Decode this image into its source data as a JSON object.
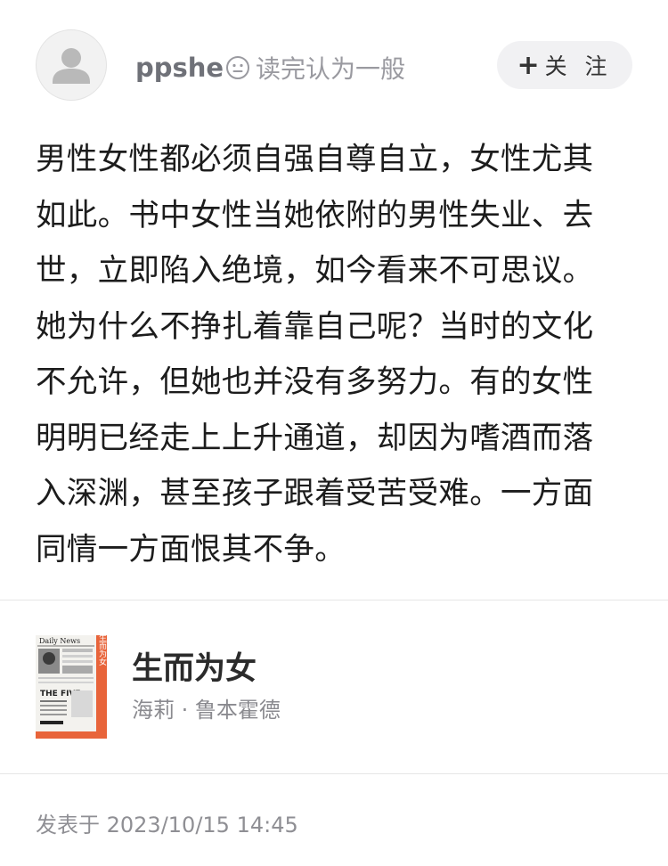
{
  "header": {
    "username": "ppshe",
    "rating_text": "读完认为一般",
    "rating_icon": "neutral-face-icon",
    "follow_label": "关 注",
    "follow_icon": "plus-icon"
  },
  "review": {
    "lines": [
      "男性女性都必须自强自尊自立，女性尤其",
      "如此。书中女性当她依附的男性失业、去",
      "世，立即陷入绝境，如今看来不可思议。",
      "她为什么不挣扎着靠自己呢？当时的文化",
      "不允许，但她也并没有多努力。有的女性",
      "明明已经走上上升通道，却因为嗜酒而落",
      "入深渊，甚至孩子跟着受苦受难。一方面",
      "同情一方面恨其不争。"
    ]
  },
  "book": {
    "title": "生而为女",
    "author": "海莉 · 鲁本霍德",
    "cover_text": {
      "masthead": "Daily News",
      "headline": "THE FIVE",
      "spine_title": "生而为女"
    },
    "cover_accent": "#e8643a"
  },
  "footer": {
    "published": "发表于 2023/10/15 14:45"
  }
}
